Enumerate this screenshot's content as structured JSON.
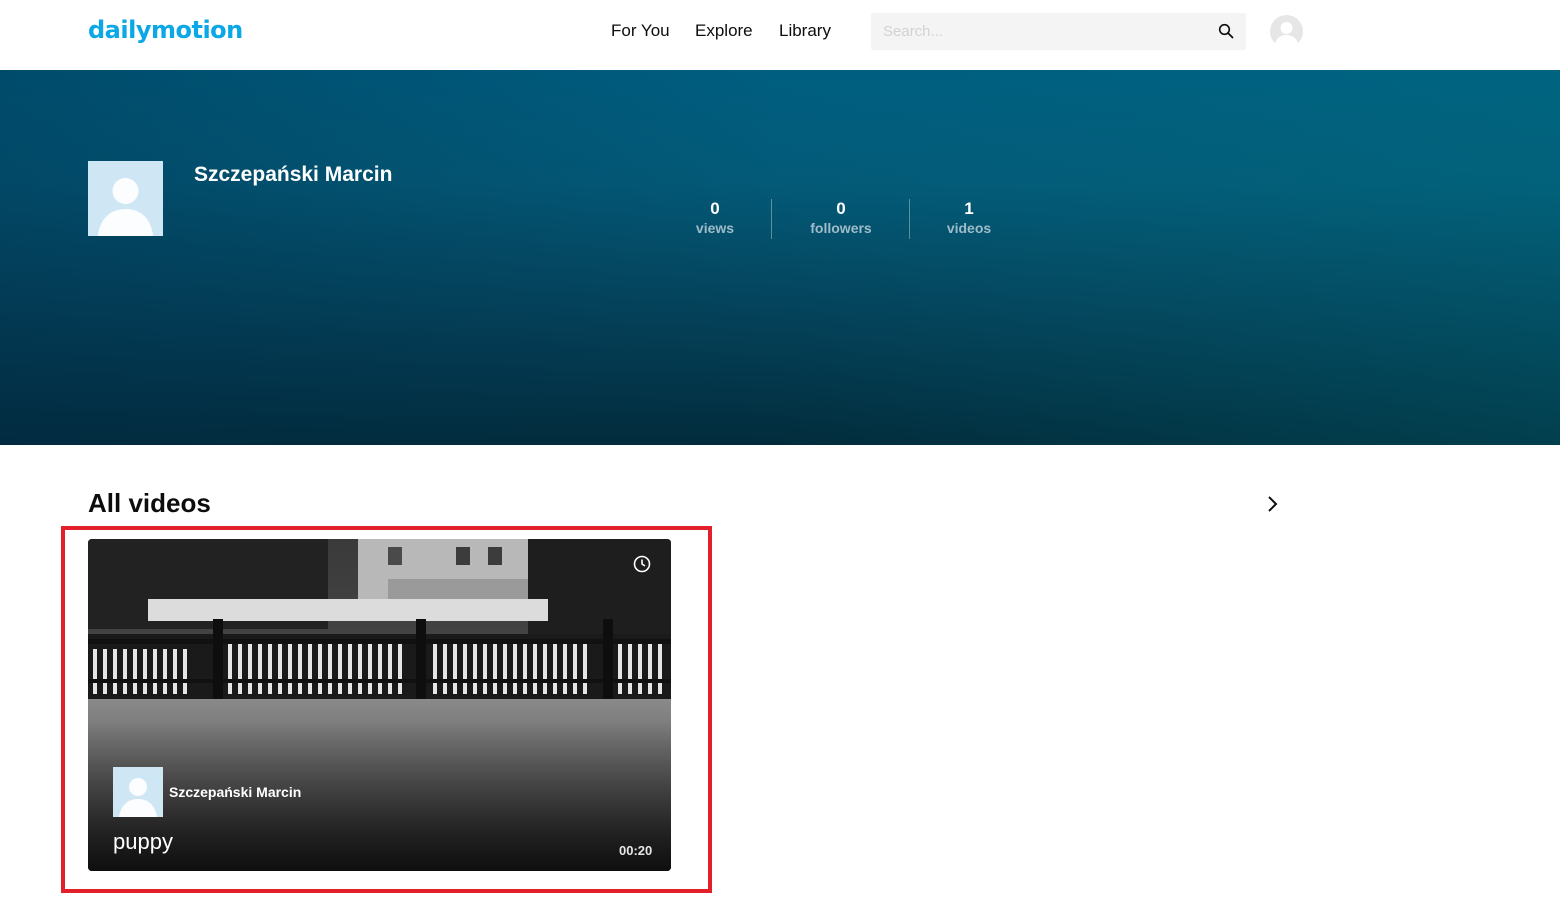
{
  "header": {
    "logo": "dailymotion",
    "nav": [
      "For You",
      "Explore",
      "Library"
    ],
    "search_placeholder": "Search..."
  },
  "profile": {
    "name": "Szczepański Marcin",
    "stats": [
      {
        "value": "0",
        "label": "views"
      },
      {
        "value": "0",
        "label": "followers"
      },
      {
        "value": "1",
        "label": "videos"
      }
    ]
  },
  "section": {
    "title": "All videos"
  },
  "video": {
    "owner": "Szczepański Marcin",
    "title": "puppy",
    "duration": "00:20"
  },
  "colors": {
    "brand": "#0aa8e6",
    "banner_top": "#005e80",
    "banner_bottom": "#022c3c",
    "highlight": "#e2202b"
  }
}
